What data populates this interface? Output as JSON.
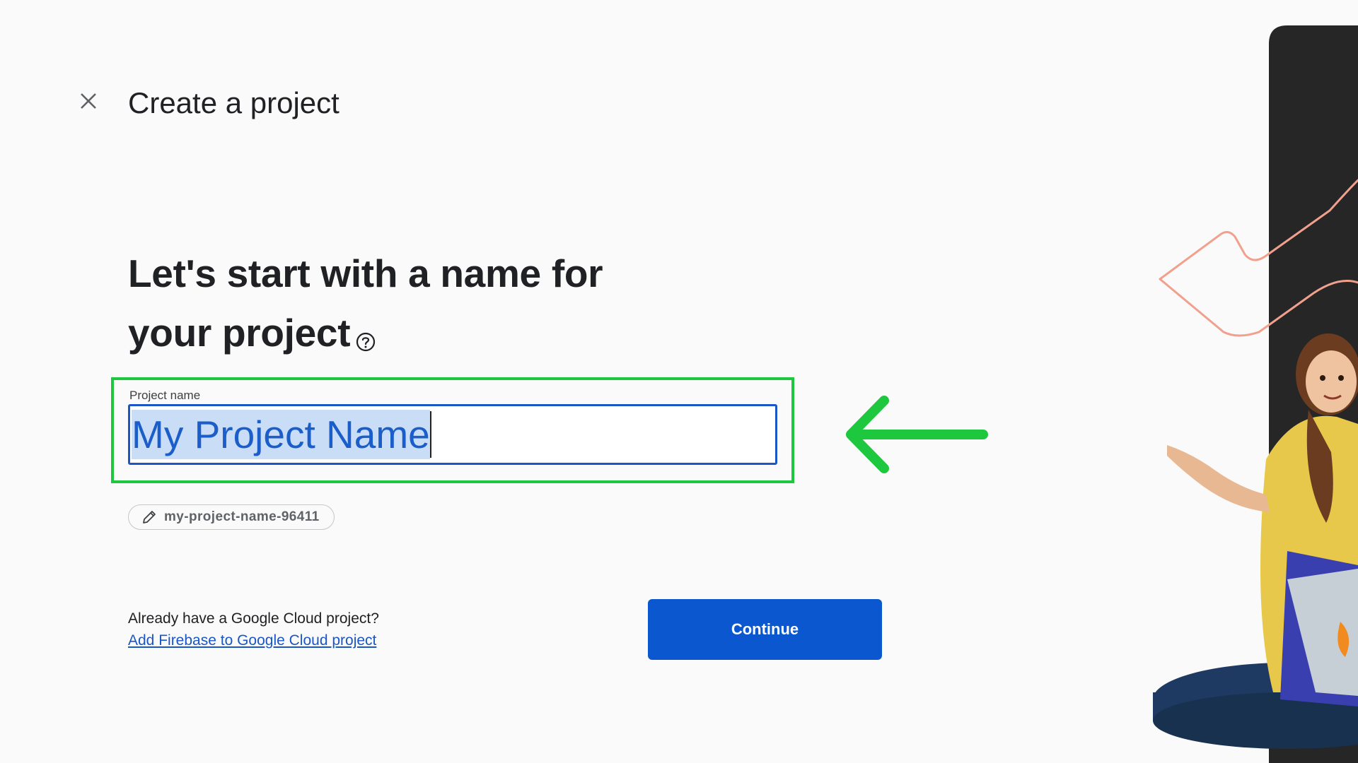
{
  "header": {
    "title": "Create a project"
  },
  "main": {
    "headline_line1": "Let's start with a name for",
    "headline_line2": "your project",
    "field": {
      "label": "Project name",
      "value": "My Project Name"
    },
    "project_id": "my-project-name-96411",
    "cloud_question": "Already have a Google Cloud project?",
    "cloud_link": "Add Firebase to Google Cloud project",
    "continue_label": "Continue"
  },
  "colors": {
    "accent": "#0b57d0",
    "highlight": "#1ec83e",
    "arrow": "#1ec83e"
  },
  "icons": {
    "close": "close-icon",
    "help": "help-icon",
    "edit": "pencil-icon",
    "arrow": "arrow-left-icon"
  }
}
